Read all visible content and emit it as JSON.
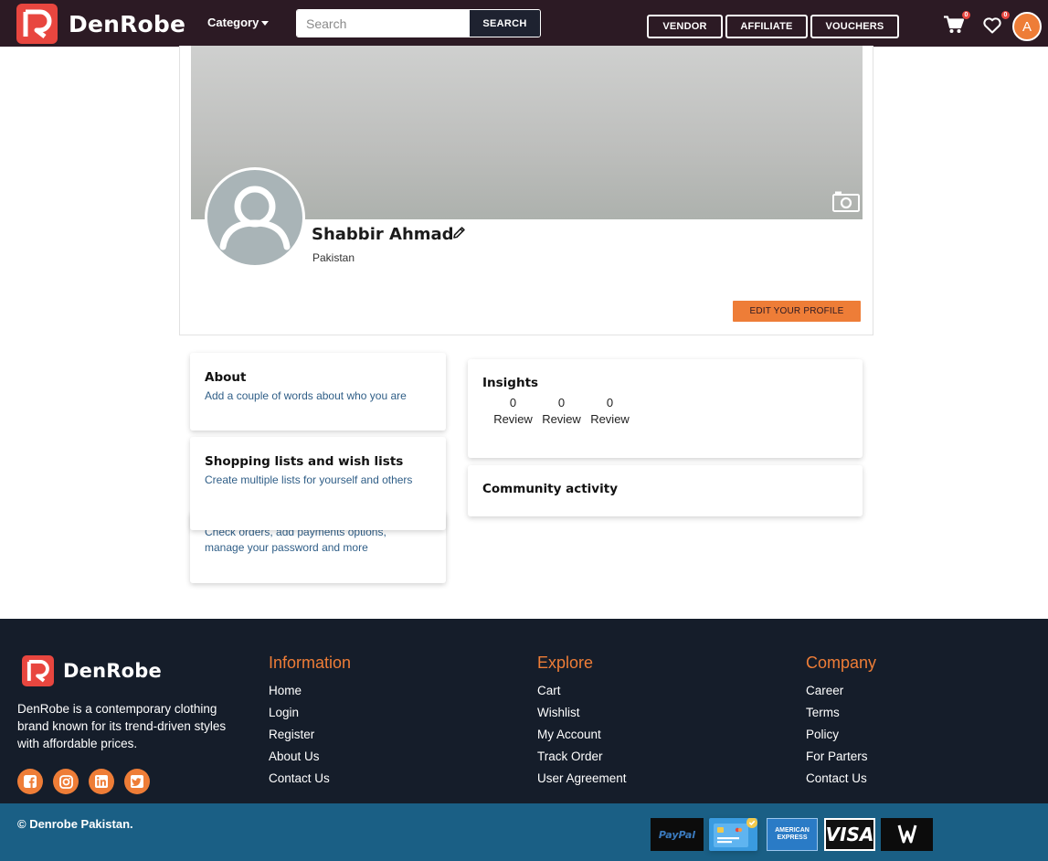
{
  "brand": {
    "name": "DenRobe",
    "accent": "#ee7d37",
    "logo_red": "#e8463f"
  },
  "navbar": {
    "category_label": "Category",
    "search_placeholder": "Search",
    "search_button": "SEARCH",
    "buttons": {
      "vendor": "VENDOR",
      "affiliate": "AFFILIATE",
      "vouchers": "VOUCHERS"
    },
    "cart_count": "0",
    "wishlist_count": "0",
    "avatar_letter": "A",
    "icons": [
      "cart-icon",
      "heart-icon",
      "chevron-down-icon"
    ]
  },
  "profile": {
    "name": "Shabbir Ahmad",
    "country": "Pakistan",
    "edit_button": "EDIT YOUR PROFILE",
    "icons": [
      "camera-icon",
      "pencil-icon",
      "user-silhouette-icon"
    ]
  },
  "cards": {
    "about": {
      "title": "About",
      "desc": "Add a couple of words about who you are"
    },
    "lists": {
      "title": "Shopping lists and wish lists",
      "desc": "Create multiple lists for yourself and others"
    },
    "account": {
      "partial_desc": "Check orders, add payments options,",
      "desc": "manage your password and more"
    },
    "insights": {
      "title": "Insights",
      "items": [
        {
          "value": "0",
          "label": "Review"
        },
        {
          "value": "0",
          "label": "Review"
        },
        {
          "value": "0",
          "label": "Review"
        }
      ]
    },
    "community": {
      "title": "Community activity"
    }
  },
  "footer": {
    "brand_name": "DenRobe",
    "about": "DenRobe is a contemporary clothing brand known for its trend-driven styles with affordable prices.",
    "socials": [
      "facebook-icon",
      "instagram-icon",
      "linkedin-icon",
      "twitter-icon"
    ],
    "columns": {
      "information": {
        "title": "Information",
        "links": [
          "Home",
          "Login",
          "Register",
          "About Us",
          "Contact Us"
        ]
      },
      "explore": {
        "title": "Explore",
        "links": [
          "Cart",
          "Wishlist",
          "My Account",
          "Track Order",
          "User Agreement"
        ]
      },
      "company": {
        "title": "Company",
        "links": [
          "Career",
          "Terms",
          "Policy",
          "For Parters",
          "Contact Us"
        ]
      }
    },
    "copyright": "© Denrobe Pakistan.",
    "payments": {
      "paypal": "PayPal",
      "amex_line1": "AMERICAN",
      "amex_line2": "EXPRESS",
      "visa": "VISA"
    }
  }
}
